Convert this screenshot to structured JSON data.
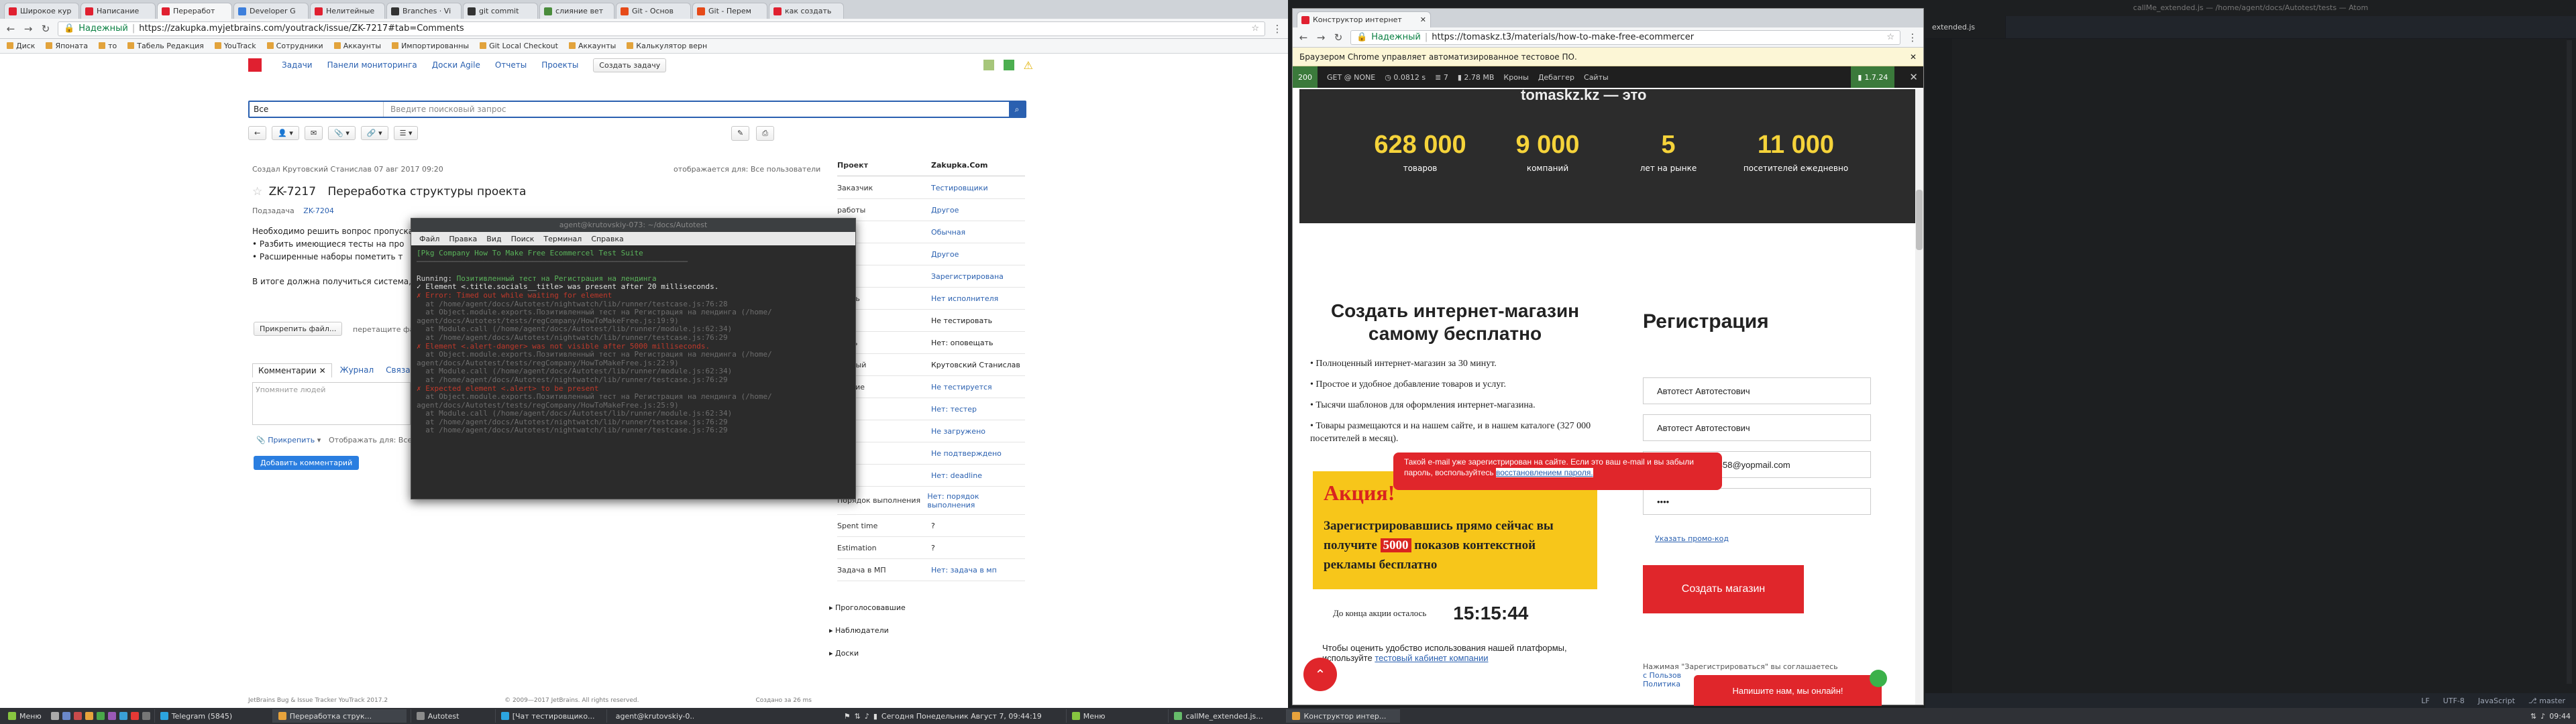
{
  "left_browser": {
    "tabs": [
      "Широкое кур",
      "Написание",
      "Переработ",
      "Developer G",
      "Нелитейные",
      "Branches · Vi",
      "git commit",
      "слияние вет",
      "Git - Основ",
      "Git - Перем",
      "как создать"
    ],
    "url": "https://zakupka.myjetbrains.com/youtrack/issue/ZK-7217#tab=Comments",
    "secure_label": "Надежный",
    "bookmarks": [
      "Диск",
      "Японата",
      "то",
      "Табель Редакция",
      "YouTrack",
      "Сотрудники",
      "Аккаунты",
      "Импортированны",
      "Git Local Checkout",
      "Аккаунты",
      "Калькулятор верн"
    ]
  },
  "youtrack": {
    "nav": [
      "Задачи",
      "Панели мониторинга",
      "Доски Agile",
      "Отчеты",
      "Проекты"
    ],
    "create_button": "Создать задачу",
    "search_context": "Все",
    "search_placeholder": "Введите поисковый запрос",
    "created_by": "Создал Крутовский Станислав 07 авг 2017 09:20",
    "visible_to": "отображается для: Все пользователи",
    "issue_id": "ZK-7217",
    "issue_title": "Переработка структуры проекта",
    "subtask_of_label": "Подзадача",
    "subtask_of": "ZK-7204",
    "description_intro": "Необходимо решить вопрос пропуска т",
    "bullets": [
      "Разбить имеющиеся тесты на про",
      "Расширенные наборы пометить т"
    ],
    "result_line": "В итоге должна получиться система, ге",
    "attach_button": "Прикрепить файл...",
    "drop_hint": "перетащите фай",
    "tabs": [
      "Комментарии",
      "Журнал",
      "Связан"
    ],
    "comment_placeholder": "Упомяните людей",
    "attach_link": "Прикрепить",
    "visible_for": "Отображать для: Все п",
    "add_comment_button": "Добавить комментарий",
    "fields_header": {
      "key": "Проект",
      "value": "Zakupka.Com"
    },
    "fields": [
      {
        "k": "Заказчик",
        "v": "Тестировщики"
      },
      {
        "k": "работы",
        "v": "Другое"
      },
      {
        "k": "тет",
        "v": "Обычная"
      },
      {
        "k": "",
        "v": "Другое"
      },
      {
        "k": "",
        "v": "Зарегистрирована"
      },
      {
        "k": "итель",
        "v": "Нет исполнителя"
      },
      {
        "k": "",
        "v": "Не тестировать"
      },
      {
        "k": "щить",
        "v": "Нет: оповещать"
      },
      {
        "k": "тенный",
        "v": "Крутовский Станислав"
      },
      {
        "k": "ование",
        "v": "Не тестируется"
      },
      {
        "k": "",
        "v": "Нет: тестер"
      },
      {
        "k": "",
        "v": "Не загружено"
      },
      {
        "k": "",
        "v": "Не подтверждено"
      },
      {
        "k": "",
        "v": "Нет: deadline"
      },
      {
        "k": "Порядок выполнения",
        "v": "Нет: порядок выполнения"
      },
      {
        "k": "Spent time",
        "v": "?"
      },
      {
        "k": "Estimation",
        "v": "?"
      },
      {
        "k": "Задача в МП",
        "v": "Нет: задача в мп"
      }
    ],
    "sections": [
      "Проголосовавшие",
      "Наблюдатели",
      "Доски"
    ],
    "footer_left": "JetBrains Bug & Issue Tracker YouTrack 2017.2",
    "footer_mid": "© 2009—2017 JetBrains. All rights reserved.",
    "footer_right": "Создано за 26 ms"
  },
  "terminal": {
    "title": "agent@krutovskiy-073: ~/docs/Autotest",
    "menu": [
      "Файл",
      "Правка",
      "Вид",
      "Поиск",
      "Терминал",
      "Справка"
    ],
    "header_line": "[Pkg Company How To Make Free Ecommercel Test Suite",
    "running_label": "Running:",
    "running_text": "Позитивленный тест на Регистрация на лендинга",
    "ok_line": "✓ Element <.title.socials__title> was present after 20 milliseconds.",
    "fail_lines": [
      "✗ Error: Timed out while waiting for element",
      "  at /home/agent/docs/Autotest/nightwatch/lib/runner/testcase.js:76:28",
      "  at Object.module.exports.Позитивленный тест на Регистрация на лендинга (/home/",
      "agent/docs/Autotest/tests/regCompany/HowToMakeFree.js:19:9)",
      "  at Module.call (/home/agent/docs/Autotest/lib/runner/module.js:62:34)",
      "  at /home/agent/docs/Autotest/nightwatch/lib/runner/testcase.js:76:29",
      "✗ Element <.alert-danger> was not visible after 5000 milliseconds.",
      "  at Object.module.exports.Позитивленный тест на Регистрация на лендинга (/home/",
      "agent/docs/Autotest/tests/regCompany/HowToMakeFree.js:22:9)",
      "  at Module.call (/home/agent/docs/Autotest/lib/runner/module.js:62:34)",
      "  at /home/agent/docs/Autotest/nightwatch/lib/runner/testcase.js:76:29",
      "✗ Expected element <.alert> to be present",
      "  at Object.module.exports.Позитивленный тест на Регистрация на лендинга (/home/",
      "agent/docs/Autotest/tests/regCompany/HowToMakeFree.js:25:9)",
      "  at Module.call (/home/agent/docs/Autotest/lib/runner/module.js:62:34)",
      "  at /home/agent/docs/Autotest/nightwatch/lib/runner/testcase.js:76:29",
      "  at /home/agent/docs/Autotest/nightwatch/lib/runner/testcase.js:76:29"
    ]
  },
  "right_browser": {
    "tab": "Конструктор интернет",
    "url": "https://tomaskz.t3/materials/how-to-make-free-ecommercer",
    "secure_label": "Надежный",
    "infobar": "Браузером Chrome управляет автоматизированное тестовое ПО.",
    "debug": {
      "status": "200",
      "route": "GET @ NONE",
      "time": "0.0812 s",
      "queries": "7",
      "memory": "2.78 MB",
      "items": [
        "Кроны",
        "Дебаггер",
        "Сайты"
      ],
      "version": "1.7.24"
    },
    "hero_fragment": "tomaskz.kz — это",
    "stats": [
      {
        "n": "628 000",
        "l": "товаров"
      },
      {
        "n": "9 000",
        "l": "компаний"
      },
      {
        "n": "5",
        "l": "лет на рынке"
      },
      {
        "n": "11 000",
        "l": "посетителей ежедневно"
      }
    ],
    "headline": "Создать интернет-магазин самому бесплатно",
    "features": [
      "Полноценный интернет-магазин за 30 минут.",
      "Простое и удобное добавление товаров и услуг.",
      "Тысячи шаблонов для оформления интернет-магазина.",
      "Товары размещаются и на нашем сайте, и в нашем каталоге (327 000 посетителей в месяц)."
    ],
    "promo_title": "Акция!",
    "promo_text_a": "Зарегистрировавшись прямо сейчас вы получите",
    "promo_badge": "5000",
    "promo_text_b": "показов контекстной рекламы бесплатно",
    "countdown_label": "До конца акции осталось",
    "countdown": "15:15:44",
    "rating_text": "Чтобы оценить удобство использования нашей платформы, используйте",
    "rating_link": "тестовый кабинет компании",
    "reg_title": "Регистрация",
    "inputs": [
      "Автотест Автотестович",
      "Автотест Автотестович",
      "g-7358@yopmail.com",
      "••••"
    ],
    "promo_code_link": "Указать промо-код",
    "submit": "Создать магазин",
    "alert_text": "Такой e-mail уже зарегистрирован на сайте. Если это ваш e-mail и вы забыли пароль, воспользуйтесь",
    "alert_link": "восстановлением пароля.",
    "bottom_note_a": "Нажимая \"Зарегистрироваться\" вы соглашаетесь",
    "bottom_note_b": "с Пользов",
    "bottom_note_c": "Политика",
    "chat": "Напишите нам, мы онлайн!"
  },
  "atom": {
    "title": "callMe_extended.js — /home/agent/docs/Autotest/tests — Atom",
    "tab": "extended.js",
    "status": [
      "LF",
      "UTF-8",
      "JavaScript",
      "master"
    ]
  },
  "taskbar": {
    "menu": "Меню",
    "items_left": [
      "Telegram (5845)",
      "Переработка струк...",
      "Autotest",
      "[Чат тестировщико...",
      "agent@krutovskiy-0..."
    ],
    "clock": "Сегодня Понедельник Август 7, 09:44:19",
    "menu2": "Меню",
    "items_right": [
      "callMe_extended.js...",
      "Конструктор интер..."
    ],
    "clock2": "09:44"
  }
}
